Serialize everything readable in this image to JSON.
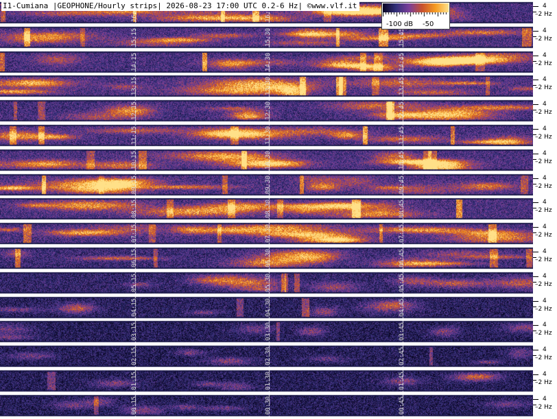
{
  "title": "I1-Cumiana |GEOPHONE/Hourly strips| 2026-08-23 17:00 UTC 0.2-6 Hz| ©www.vlf.it",
  "legend": {
    "min_label": "-100 dB",
    "max_label": "-50",
    "colormap": [
      "#0b0726",
      "#33307a",
      "#7a3f9a",
      "#c9522e",
      "#f59a22",
      "#ffe088"
    ]
  },
  "freq_axis": {
    "upper_label": "4",
    "lower_label": "2 Hz"
  },
  "strips": [
    {
      "hour": 16,
      "labels": [
        "16:15",
        "16:30",
        "16:45"
      ],
      "intensity": 0.75
    },
    {
      "hour": 15,
      "labels": [
        "15:15",
        "15:30",
        "15:45"
      ],
      "intensity": 0.8
    },
    {
      "hour": 14,
      "labels": [
        "14:15",
        "14:30",
        "14:45"
      ],
      "intensity": 0.78
    },
    {
      "hour": 13,
      "labels": [
        "13:15",
        "13:30",
        "13:45"
      ],
      "intensity": 0.85
    },
    {
      "hour": 12,
      "labels": [
        "12:15",
        "12:30",
        "12:45"
      ],
      "intensity": 0.72
    },
    {
      "hour": 11,
      "labels": [
        "11:15",
        "11:30",
        "11:45"
      ],
      "intensity": 0.8
    },
    {
      "hour": 10,
      "labels": [
        "10:15",
        "10:30",
        "10:45"
      ],
      "intensity": 0.82
    },
    {
      "hour": 9,
      "labels": [
        "09:15",
        "09:30",
        "09:45"
      ],
      "intensity": 0.85
    },
    {
      "hour": 8,
      "labels": [
        "08:15",
        "08:30",
        "08:45"
      ],
      "intensity": 0.83
    },
    {
      "hour": 7,
      "labels": [
        "07:15",
        "07:30",
        "07:45"
      ],
      "intensity": 0.8
    },
    {
      "hour": 6,
      "labels": [
        "06:15",
        "06:30",
        "06:45"
      ],
      "intensity": 0.6
    },
    {
      "hour": 5,
      "labels": [
        "05:15",
        "05:30",
        "05:45"
      ],
      "intensity": 0.45
    },
    {
      "hour": 4,
      "labels": [
        "04:15",
        "04:30",
        "04:45"
      ],
      "intensity": 0.3
    },
    {
      "hour": 3,
      "labels": [
        "03:15",
        "03:30",
        "03:45"
      ],
      "intensity": 0.22
    },
    {
      "hour": 2,
      "labels": [
        "02:15",
        "02:30",
        "02:45"
      ],
      "intensity": 0.2
    },
    {
      "hour": 1,
      "labels": [
        "01:15",
        "01:30",
        "01:45"
      ],
      "intensity": 0.22
    },
    {
      "hour": 0,
      "labels": [
        "00:15",
        "00:30",
        "00:45"
      ],
      "intensity": 0.2
    }
  ]
}
